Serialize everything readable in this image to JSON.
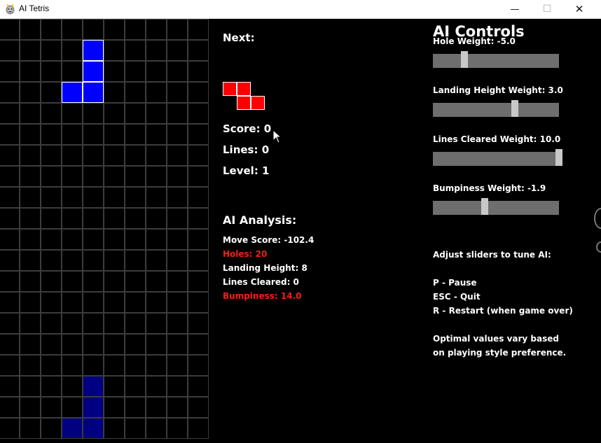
{
  "window": {
    "title": "AI Tetris",
    "minimize_glyph": "—",
    "maximize_glyph": "☐",
    "close_glyph": "✕"
  },
  "colors": {
    "active_piece": "#0000ff",
    "ghost_piece": "#000080",
    "next_piece": "#ff0000",
    "grid_line": "#3c3c3c",
    "slider_track": "#6e6e6e",
    "slider_thumb": "#c8c8c8",
    "warning": "#ff1a1a"
  },
  "board": {
    "columns": 10,
    "rows": 20,
    "active_piece_cells": [
      [
        4,
        1
      ],
      [
        4,
        2
      ],
      [
        3,
        3
      ],
      [
        4,
        3
      ]
    ],
    "ghost_piece_cells": [
      [
        4,
        17
      ],
      [
        4,
        18
      ],
      [
        3,
        19
      ],
      [
        4,
        19
      ]
    ]
  },
  "next": {
    "label": "Next:",
    "piece": "Z",
    "cells": [
      [
        0,
        0
      ],
      [
        1,
        0
      ],
      [
        1,
        1
      ],
      [
        2,
        1
      ]
    ]
  },
  "stats": {
    "score": "Score: 0",
    "lines": "Lines: 0",
    "level": "Level: 1"
  },
  "analysis": {
    "title": "AI Analysis:",
    "move_score": "Move Score: -102.4",
    "holes": "Holes: 20",
    "landing_height": "Landing Height: 8",
    "lines_cleared": "Lines Cleared: 0",
    "bumpiness": "Bumpiness: 14.0"
  },
  "controls": {
    "title": "AI Controls",
    "sliders": [
      {
        "label": "Hole Weight: -5.0",
        "value": -5.0,
        "fraction": 0.25
      },
      {
        "label": "Landing Height Weight: 3.0",
        "value": 3.0,
        "fraction": 0.65
      },
      {
        "label": "Lines Cleared Weight: 10.0",
        "value": 10.0,
        "fraction": 1.0
      },
      {
        "label": "Bumpiness Weight: -1.9",
        "value": -1.9,
        "fraction": 0.41
      }
    ]
  },
  "help": {
    "adjust": "Adjust sliders to tune AI:",
    "pause": "P - Pause",
    "quit": "ESC - Quit",
    "restart": "R - Restart (when game over)",
    "note1": "Optimal values vary based",
    "note2": "on playing style preference."
  }
}
